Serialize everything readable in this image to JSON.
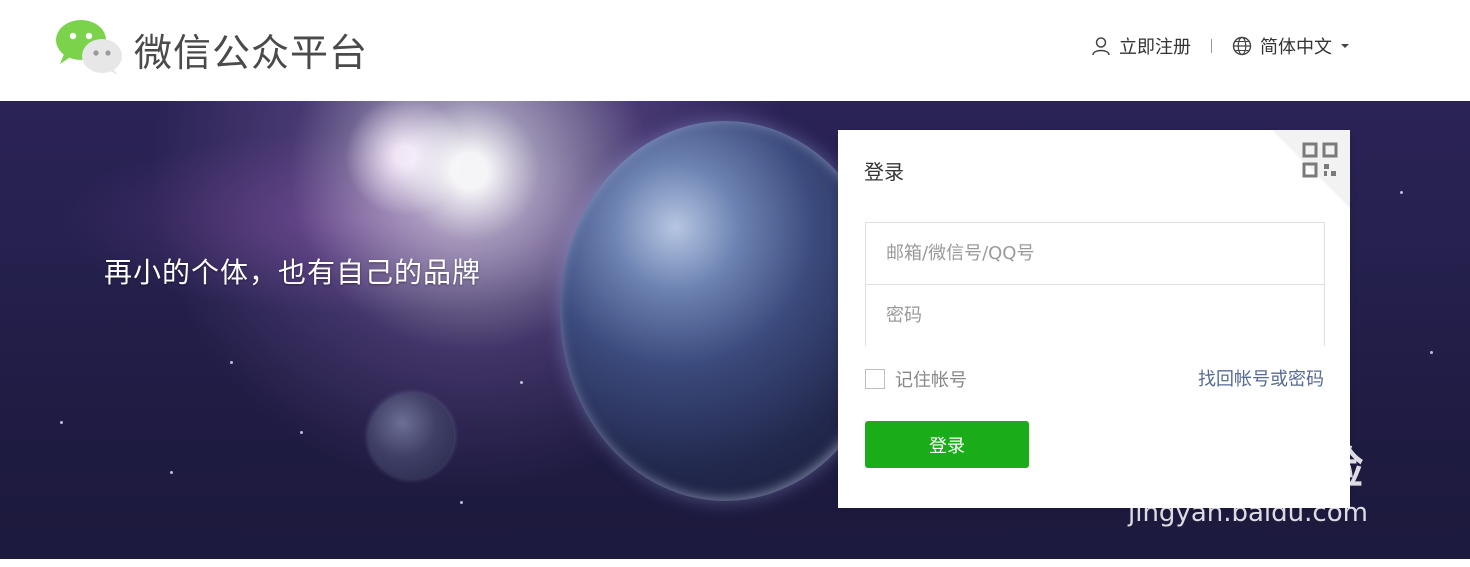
{
  "header": {
    "brand": "微信公众平台",
    "register_label": "立即注册",
    "language_label": "简体中文"
  },
  "banner": {
    "slogan": "再小的个体，也有自己的品牌"
  },
  "login": {
    "title": "登录",
    "account_placeholder": "邮箱/微信号/QQ号",
    "password_placeholder": "密码",
    "remember_label": "记住帐号",
    "forgot_label": "找回帐号或密码",
    "submit_label": "登录",
    "qr_icon": "qrcode-icon"
  },
  "watermark": {
    "line1": "Baidu经验",
    "line2": "jingyan.baidu.com"
  },
  "colors": {
    "accent_green": "#1aad19",
    "link_blue": "#576b95",
    "text_dark": "#353535"
  }
}
